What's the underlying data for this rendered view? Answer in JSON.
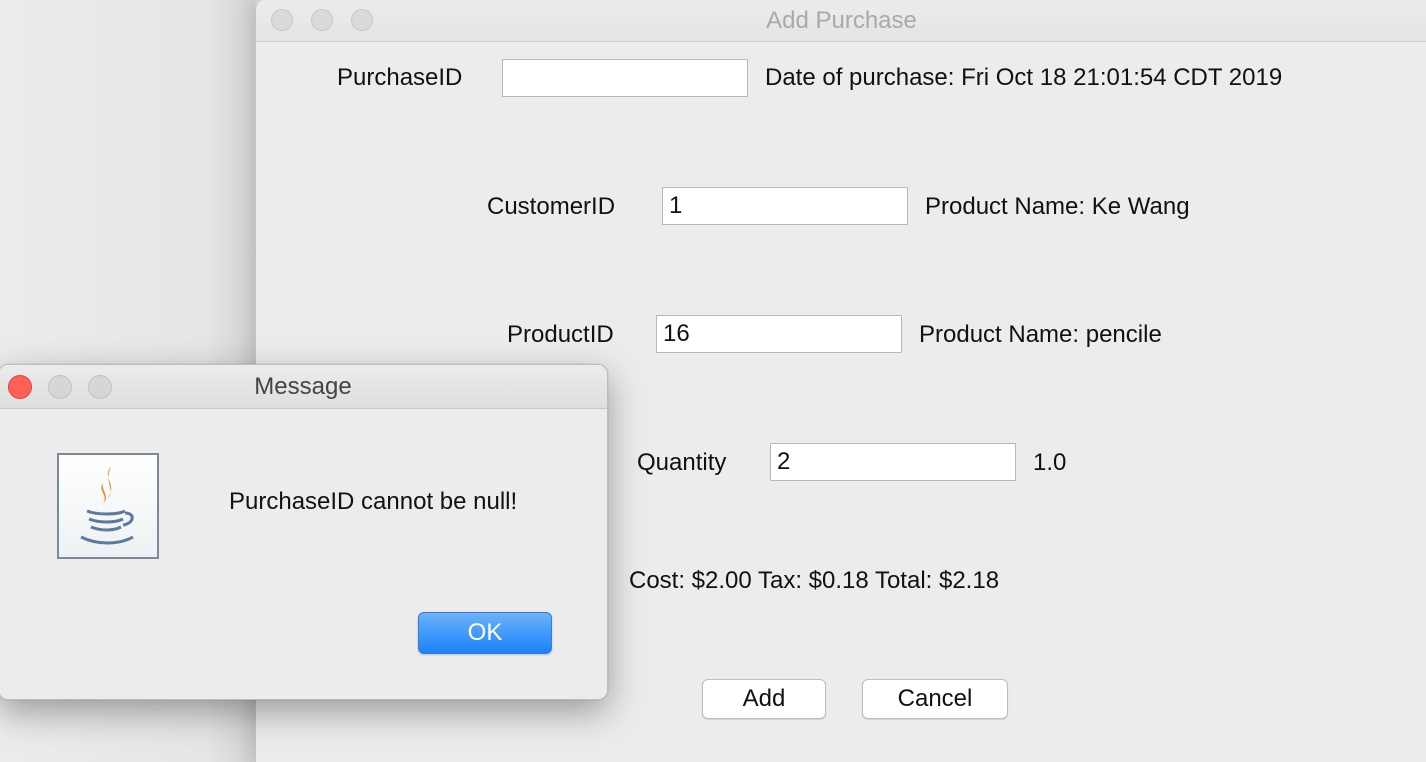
{
  "main_window": {
    "title": "Add Purchase",
    "purchase_id_label": "PurchaseID",
    "purchase_id_value": "",
    "date_text": "Date of purchase: Fri Oct 18 21:01:54 CDT 2019",
    "customer_id_label": "CustomerID",
    "customer_id_value": "1",
    "customer_name_text": "Product Name: Ke Wang",
    "product_id_label": "ProductID",
    "product_id_value": "16",
    "product_name_text": "Product Name: pencile",
    "quantity_label": "Quantity",
    "quantity_value": "2",
    "unit_price_text": "1.0",
    "totals_text": "Cost: $2.00 Tax: $0.18 Total: $2.18",
    "add_button": "Add",
    "cancel_button": "Cancel"
  },
  "dialog": {
    "title": "Message",
    "message": "PurchaseID cannot be null!",
    "ok_button": "OK",
    "icon": "java-icon"
  },
  "colors": {
    "window_bg": "#ececec",
    "close_button": "#fe5f57",
    "ok_button": "#1a82fb"
  }
}
